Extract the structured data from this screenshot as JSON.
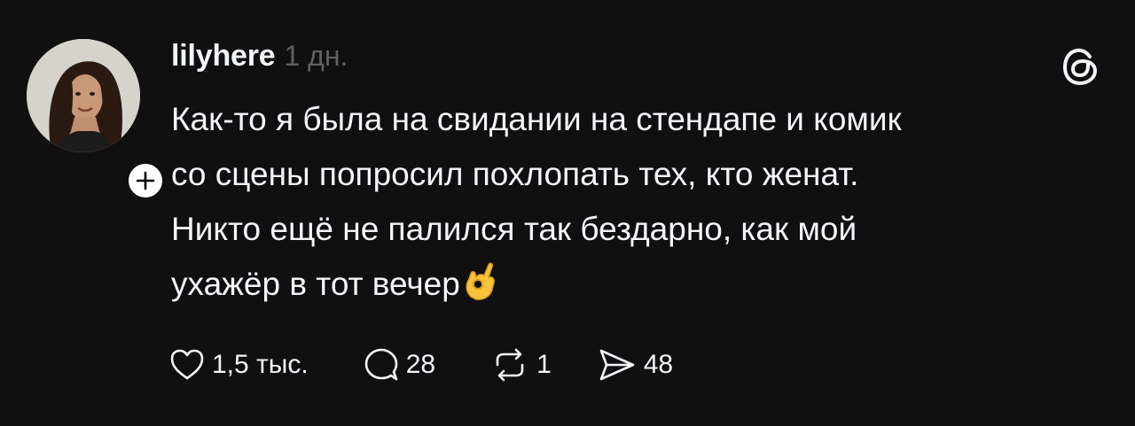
{
  "post": {
    "username": "lilyhere",
    "timestamp": "1 дн.",
    "text_lines": [
      "Как-то я была на свидании на стендапе и комик",
      "со сцены попросил похлопать тех, кто женат.",
      "Никто ещё не палился так бездарно, как мой",
      "ухажёр в тот вечер"
    ],
    "emoji": "ok-hand-emoji"
  },
  "actions": {
    "like_count": "1,5 тыс.",
    "reply_count": "28",
    "repost_count": "1",
    "share_count": "48"
  },
  "icons": {
    "like": "heart-icon",
    "reply": "speech-bubble-icon",
    "repost": "repost-icon",
    "share": "send-icon",
    "brand": "threads-logo-icon",
    "follow": "plus-icon"
  },
  "colors": {
    "background": "#101010",
    "text": "#f3f5f7",
    "muted": "#616161"
  }
}
